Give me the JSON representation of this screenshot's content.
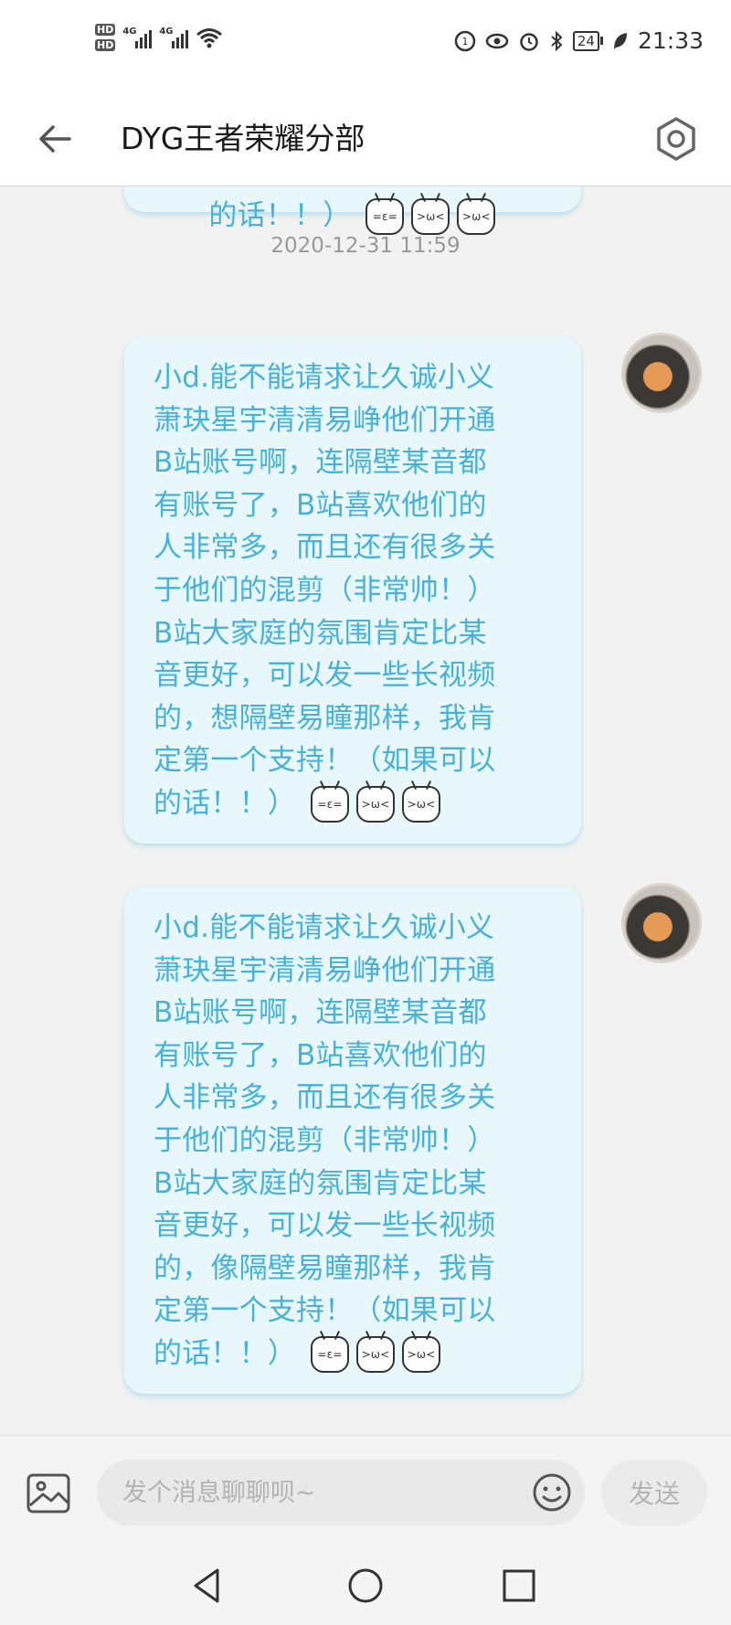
{
  "status_bar": {
    "hd1": "HD",
    "hd2": "HD",
    "net1": "4G",
    "net2": "4G",
    "battery": "24",
    "time": "21:33"
  },
  "header": {
    "title": "DYG王者荣耀分部"
  },
  "chat": {
    "prev_tail": "的话！！）",
    "timestamp": "2020-12-31 11:59",
    "messages": [
      {
        "text": "小d.能不能请求让久诚小义\n萧玦星宇清清易峥他们开通\nB站账号啊，连隔壁某音都\n有账号了，B站喜欢他们的\n人非常多，而且还有很多关\n于他们的混剪（非常帅！）\nB站大家庭的氛围肯定比某\n音更好，可以发一些长视频\n的，想隔壁易瞳那样，我肯\n定第一个支持！（如果可以\n的话！！）"
      },
      {
        "text": "小d.能不能请求让久诚小义\n萧玦星宇清清易峥他们开通\nB站账号啊，连隔壁某音都\n有账号了，B站喜欢他们的\n人非常多，而且还有很多关\n于他们的混剪（非常帅！）\nB站大家庭的氛围肯定比某\n音更好，可以发一些长视频\n的，像隔壁易瞳那样，我肯\n定第一个支持！（如果可以\n的话！！）"
      }
    ]
  },
  "input_bar": {
    "placeholder": "发个消息聊聊呗~",
    "send_label": "发送"
  },
  "icons": {
    "back": "arrow-left-icon",
    "settings": "hexagon-gear-icon",
    "image": "image-icon",
    "emoji": "smiley-icon",
    "emote": "bilibili-tv-emote-icon"
  },
  "colors": {
    "bubble_bg": "#e8f7fc",
    "bubble_text": "#48b1d6",
    "background": "#f2f2f2"
  }
}
